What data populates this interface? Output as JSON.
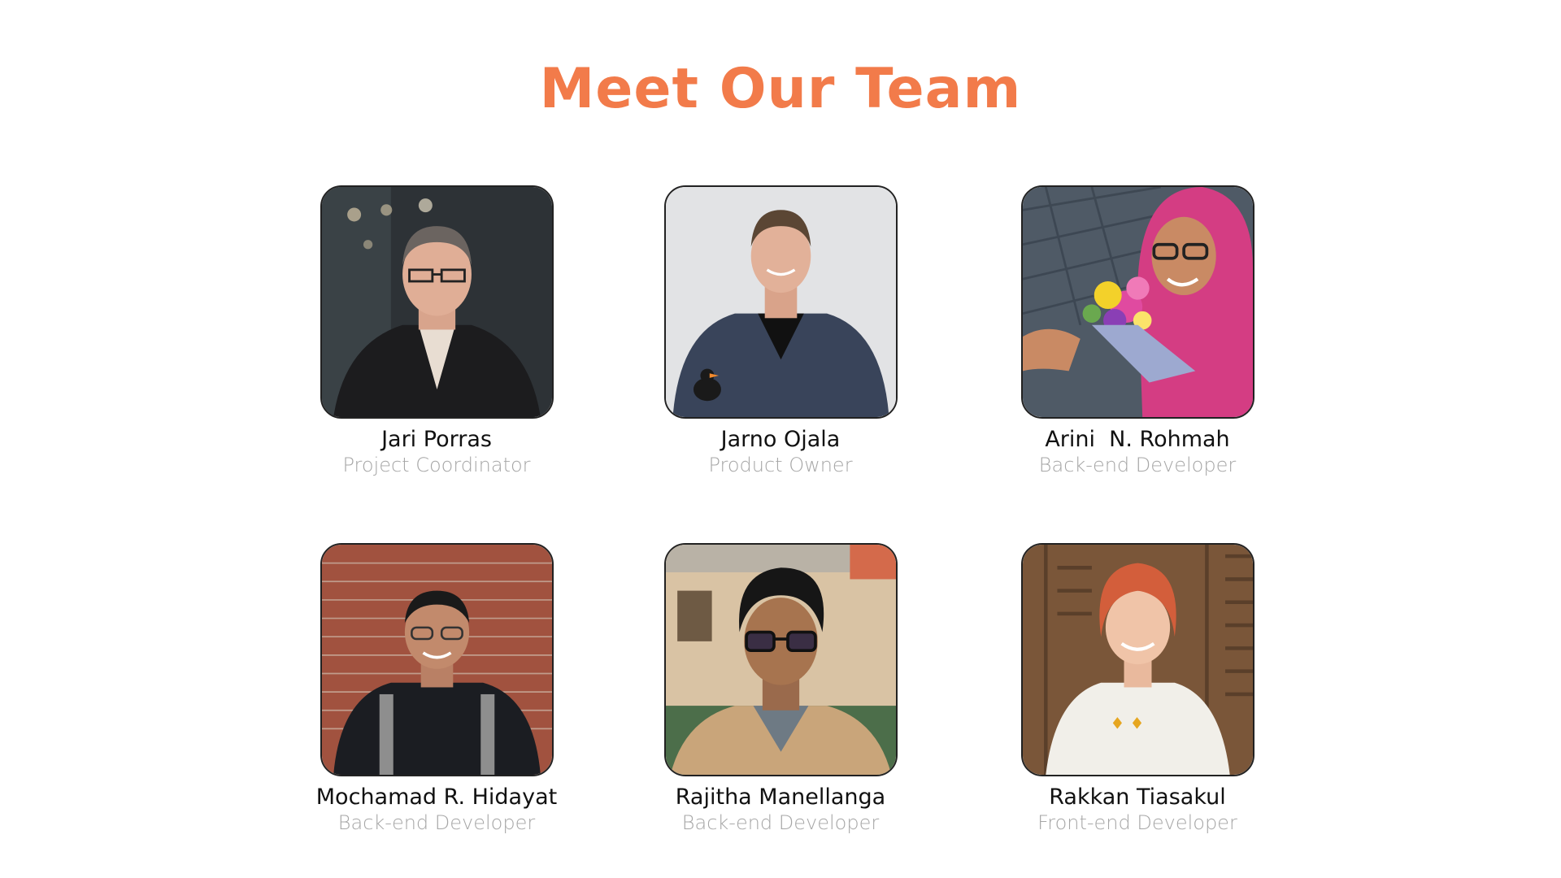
{
  "page": {
    "title": "Meet Our Team",
    "accent_color": "#F27B4A"
  },
  "team": [
    {
      "name": "Jari Porras",
      "role": "Project Coordinator"
    },
    {
      "name": "Jarno Ojala",
      "role": "Product Owner"
    },
    {
      "name": "Arini  N. Rohmah",
      "role": "Back-end Developer"
    },
    {
      "name": "Mochamad R. Hidayat",
      "role": "Back-end Developer"
    },
    {
      "name": "Rajitha Manellanga",
      "role": "Back-end Developer"
    },
    {
      "name": "Rakkan Tiasakul",
      "role": "Front-end Developer"
    }
  ]
}
